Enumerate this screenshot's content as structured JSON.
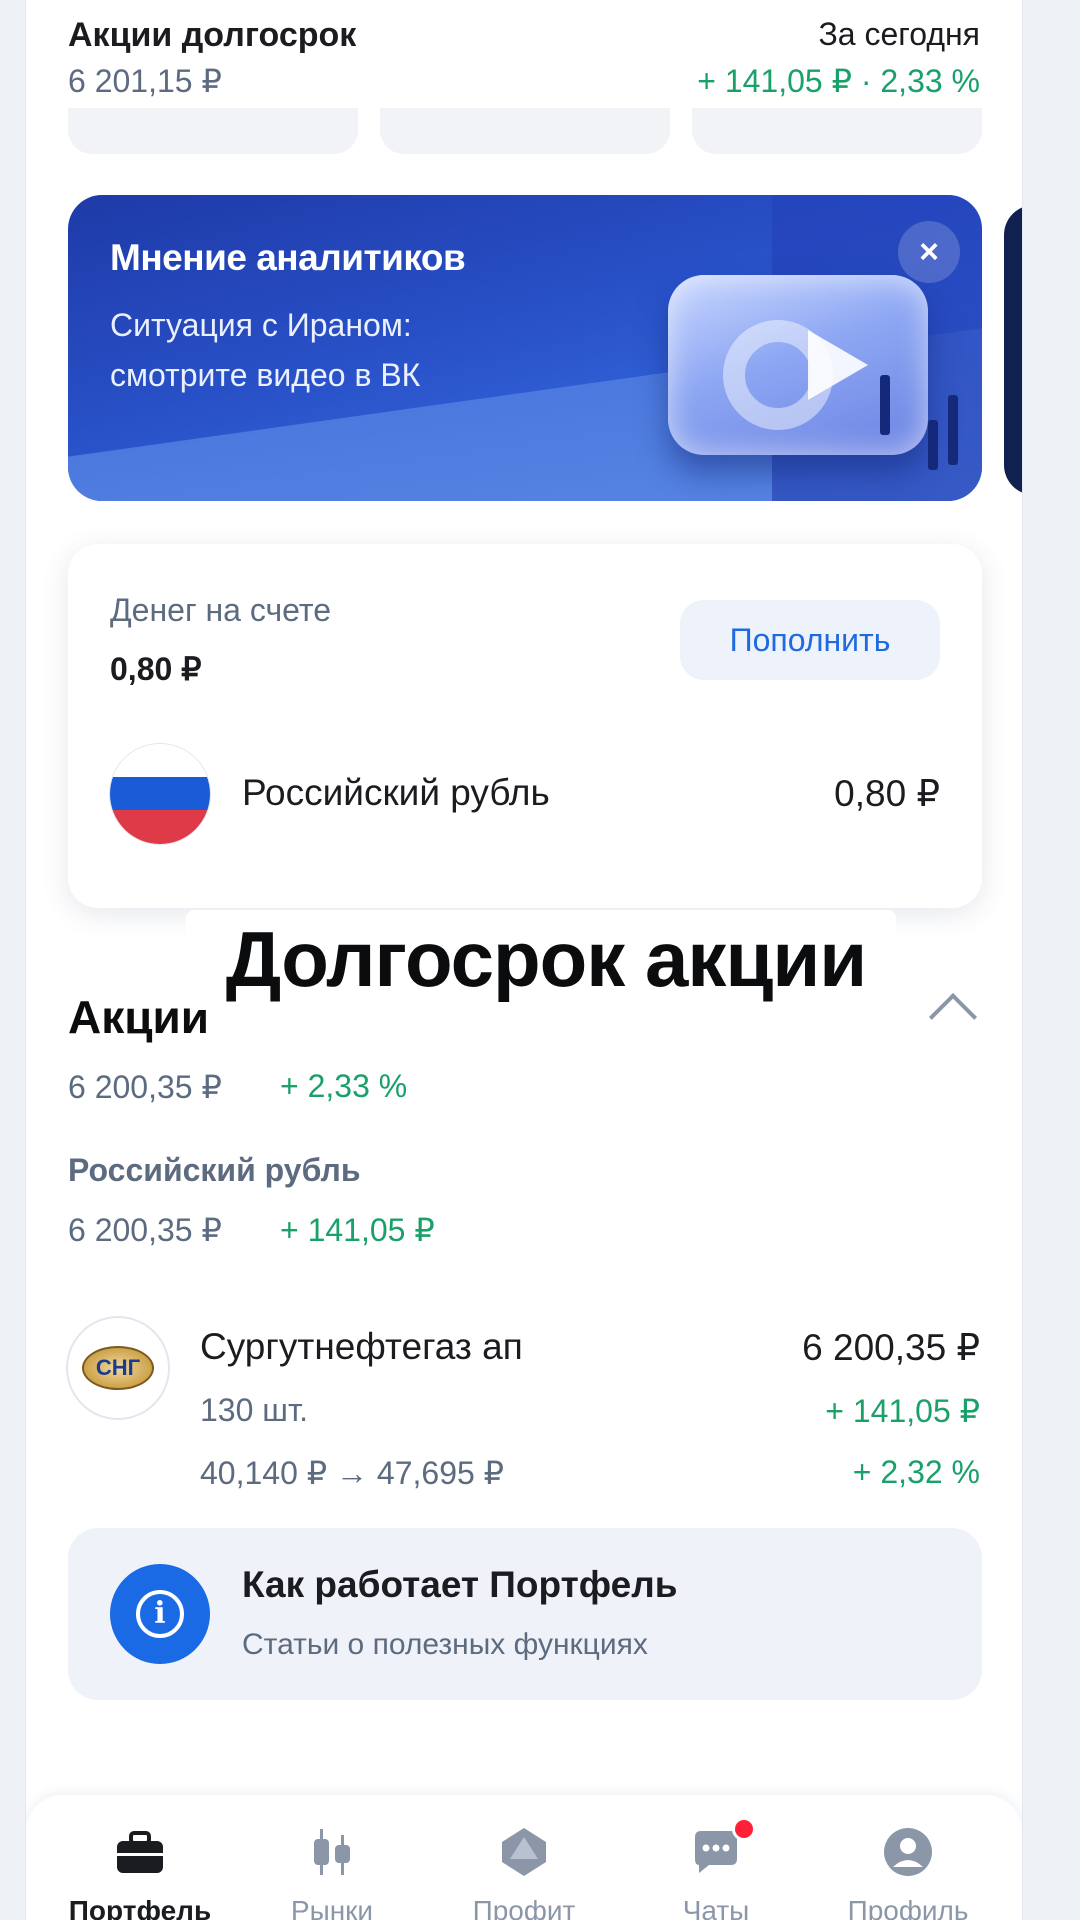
{
  "header": {
    "title": "Акции долгосрок",
    "value": "6 201,15 ₽",
    "period_label": "За сегодня",
    "change": "+ 141,05 ₽ · 2,33 %"
  },
  "banner": {
    "title": "Мнение аналитиков",
    "text": "Ситуация с Ираном: смотрите видео в ВК",
    "close": "×"
  },
  "balance": {
    "label": "Денег на счете",
    "value": "0,80 ₽",
    "topup_label": "Пополнить",
    "currency_name": "Российский рубль",
    "currency_value": "0,80 ₽"
  },
  "overlay_caption": "Долгосрок акции",
  "stocks": {
    "title": "Акции",
    "total": "6 200,35 ₽",
    "total_pct": "+ 2,33 %",
    "group_title": "Российский рубль",
    "group_total": "6 200,35 ₽",
    "group_change": "+ 141,05 ₽",
    "items": [
      {
        "logo_text": "СНГ",
        "name": "Сургутнефтегаз ап",
        "value": "6 200,35 ₽",
        "qty": "130 шт.",
        "change": "+ 141,05 ₽",
        "price": "40,140 ₽ → 47,695 ₽",
        "pct": "+ 2,32 %"
      }
    ]
  },
  "info": {
    "title": "Как работает Портфель",
    "subtitle": "Статьи о полезных функциях"
  },
  "nav": [
    {
      "label": "Портфель",
      "icon": "briefcase-icon",
      "active": true
    },
    {
      "label": "Рынки",
      "icon": "candles-icon",
      "active": false
    },
    {
      "label": "Профит",
      "icon": "profit-icon",
      "active": false
    },
    {
      "label": "Чаты",
      "icon": "chat-icon",
      "active": false,
      "badge": true
    },
    {
      "label": "Профиль",
      "icon": "profile-icon",
      "active": false
    }
  ],
  "colors": {
    "accent": "#1f6ae0",
    "positive": "#1aa16a",
    "secondary_text": "#5d6b80",
    "badge": "#ff2236"
  }
}
